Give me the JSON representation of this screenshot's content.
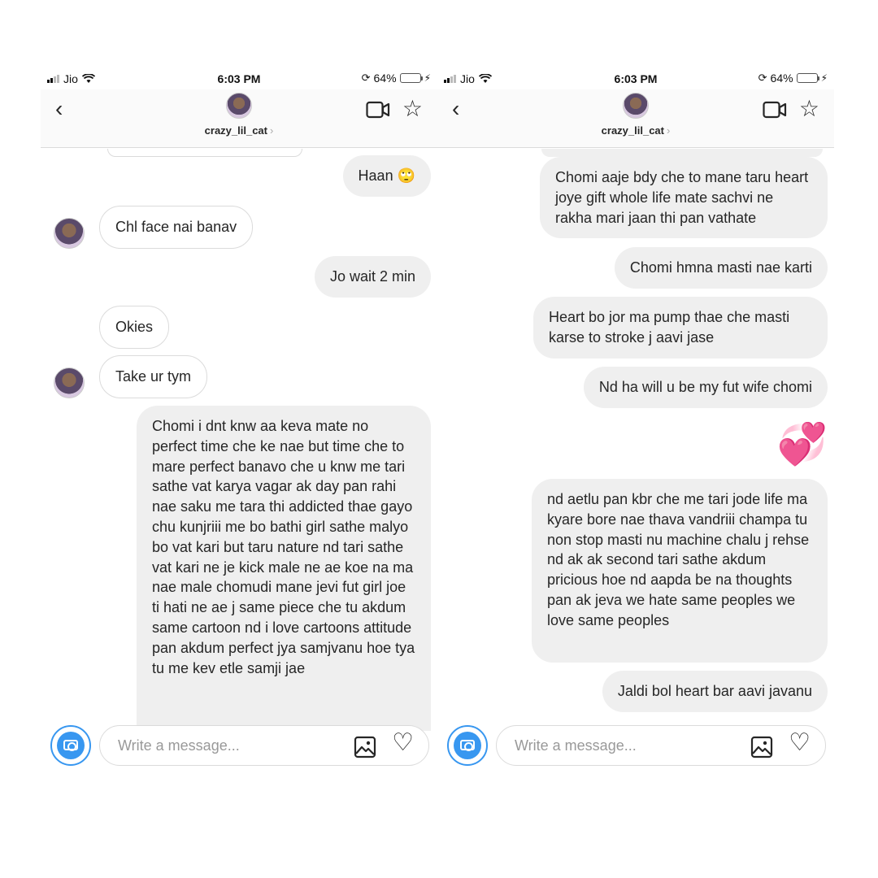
{
  "status_bar": {
    "carrier": "Jio",
    "time": "6:03 PM",
    "battery": "64%",
    "battery_level": 0.64
  },
  "header": {
    "username": "crazy_lil_cat",
    "chevron": "›",
    "back_icon": "back-chevron-icon",
    "video_icon": "video-call-icon",
    "star_icon": "star-icon"
  },
  "composer": {
    "placeholder": "Write a message...",
    "camera_icon": "camera-icon",
    "gallery_icon": "gallery-icon",
    "like_icon": "heart-icon"
  },
  "colors": {
    "accent": "#3897f0",
    "sent_bubble": "#efefef",
    "border": "#dbdbdb",
    "battery": "#4cd964",
    "heart": "#ee3d8e"
  },
  "left_chat": {
    "messages": [
      {
        "side": "sent",
        "text": "Haan 🙄"
      },
      {
        "side": "received",
        "text": "Chl face nai banav"
      },
      {
        "side": "sent",
        "text": "Jo wait 2 min"
      },
      {
        "side": "received",
        "text": "Okies"
      },
      {
        "side": "received",
        "text": "Take ur tym"
      },
      {
        "side": "sent",
        "text": "Chomi i dnt knw aa keva mate no perfect time che ke nae but time che to mare perfect banavo che u knw me tari sathe vat karya vagar ak day pan rahi nae saku me tara thi addicted thae gayo chu kunjriii me bo bathi girl sathe malyo bo vat kari but taru nature nd tari sathe vat kari ne je kick male ne ae koe na ma nae male chomudi mane jevi fut girl joe ti hati ne ae j same piece che tu akdum same cartoon nd i love cartoons attitude pan akdum perfect jya samjvanu hoe tya tu me kev etle samji jae"
      }
    ]
  },
  "right_chat": {
    "messages": [
      {
        "side": "sent",
        "text": "Chomi aaje bdy che to mane taru heart joye gift whole life mate sachvi ne rakha mari jaan thi pan vathate"
      },
      {
        "side": "sent",
        "text": "Chomi hmna masti nae karti"
      },
      {
        "side": "sent",
        "text": "Heart bo jor ma pump thae che masti karse to stroke j aavi jase"
      },
      {
        "side": "sent",
        "text": "Nd ha will u be my fut wife chomi"
      },
      {
        "side": "sent",
        "text": "💞"
      },
      {
        "side": "sent",
        "text": "nd aetlu pan kbr che me tari jode life ma kyare bore nae thava vandriii champa tu non stop masti nu machine chalu j rehse nd ak ak second tari sathe akdum pricious hoe nd aapda be na thoughts pan ak jeva we hate same peoples we love same peoples"
      },
      {
        "side": "sent",
        "text": "Jaldi bol heart bar aavi javanu"
      }
    ]
  }
}
